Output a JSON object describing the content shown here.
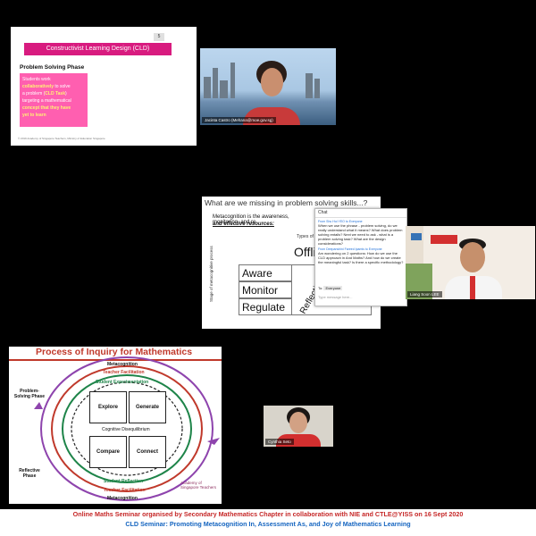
{
  "slide1": {
    "number": "5",
    "title": "Constructivist Learning Design (CLD)",
    "phase": "Problem Solving Phase",
    "bullet": [
      {
        "text": "Students work",
        "hl": false
      },
      {
        "text": "collaboratively",
        "hl": true
      },
      {
        "text": " to solve",
        "hl": false
      },
      {
        "text": "a problem (",
        "hl": false
      },
      {
        "text": "CLD Task",
        "hl": true
      },
      {
        "text": ")",
        "hl": false
      },
      {
        "text": "targeting a mathematical",
        "hl": false
      },
      {
        "text": "concept that they have",
        "hl": true
      },
      {
        "text": "yet to learn",
        "hl": true
      }
    ],
    "footer": "© 2019 Academy of Singapore Teachers, Ministry of Education Singapore"
  },
  "video1": {
    "name": "Jacinta Castro (Mehana@moe.gov.sg)"
  },
  "slide2": {
    "title": "What are we missing in problem solving skills...?",
    "line1": "Metacognition is the awareness, monitoring, and re",
    "line2": "and effective resources:",
    "types": "Types of",
    "column": "Offli",
    "rows": [
      "Aware",
      "Monitor",
      "Regulate"
    ],
    "vertical": "Stage of metacognitive process",
    "reflective": "Reflectiv"
  },
  "chat": {
    "header": "Chat",
    "messages": [
      {
        "from": "From Shu Hui YEO to Everyone",
        "text": "When we use the phrase - problem solving, do we really understand what it means? What does problem solving entails? Next we need to ask - what is a problem solving task? What are the design considerations?"
      },
      {
        "from": "From Deepanshini Fareed Ipamis to Everyone",
        "text": "Am wondering on 2 questions: How do we use the CLD approach in And Maths? And how do we create the meaningful task? Is there a specific methodology?"
      }
    ],
    "to_label": "To:",
    "to_value": "Everyone",
    "placeholder": "Type message here..."
  },
  "video2": {
    "name": "Liang Soon LEE"
  },
  "slide3": {
    "title": "Process of Inquiry for Mathematics",
    "metacog_top": "Metacognition",
    "teacher_top": "Teacher Facilitation",
    "experimentation": "Student Experimentation",
    "problem_phase": "Problem-Solving Phase",
    "reflective_phase": "Reflective Phase",
    "explore": "Explore",
    "generate": "Generate",
    "compare": "Compare",
    "connect": "Connect",
    "disequilibrium": "Cognitive Disequilibrium",
    "reflection": "Student Reflection",
    "teacher_bottom": "Teacher Facilitation",
    "metacog_bottom": "Metacognition",
    "logo": "Academy of Singapore Teachers"
  },
  "video3": {
    "name": "Cynthia Seto"
  },
  "captions": {
    "line1": "Online Maths Seminar organised by Secondary Mathematics Chapter in collaboration with NIE and CTLE@YISS on 16 Sept 2020",
    "line2": "CLD Seminar: Promoting Metacognition In,  Assessment As, and Joy of Mathematics Learning"
  }
}
